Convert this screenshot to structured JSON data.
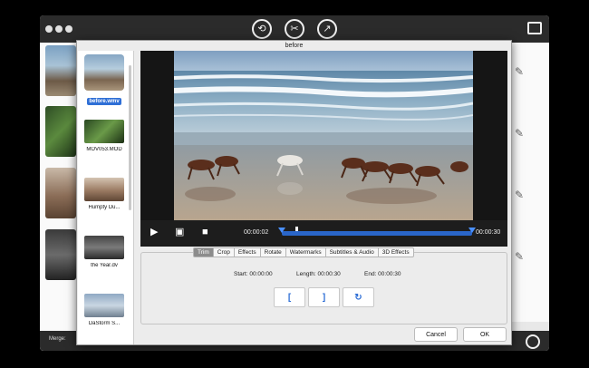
{
  "dialog": {
    "title": "before"
  },
  "files": [
    {
      "label": "before.wmv",
      "selected": true
    },
    {
      "label": "MOV053.MOD",
      "selected": false
    },
    {
      "label": "Humpty Du...",
      "selected": false
    },
    {
      "label": "the Year.dv",
      "selected": false
    },
    {
      "label": "DaStorm S...",
      "selected": false
    }
  ],
  "player": {
    "current_time": "00:00:02",
    "end_time": "00:00:30",
    "progress": 0.07
  },
  "tabs": [
    {
      "label": "Trim",
      "active": true
    },
    {
      "label": "Crop",
      "active": false
    },
    {
      "label": "Effects",
      "active": false
    },
    {
      "label": "Rotate",
      "active": false
    },
    {
      "label": "Watermarks",
      "active": false
    },
    {
      "label": "Subtitles & Audio",
      "active": false
    },
    {
      "label": "3D Effects",
      "active": false
    }
  ],
  "trim": {
    "start": "Start: 00:00:00",
    "length": "Length: 00:00:30",
    "end": "End: 00:00:30",
    "set_start_glyph": "[",
    "set_end_glyph": "]",
    "reset_glyph": "↻"
  },
  "buttons": {
    "cancel": "Cancel",
    "ok": "OK"
  },
  "main_window": {
    "merge_label": "Merge:"
  },
  "colors": {
    "accent": "#2f6fd6",
    "toolbar": "#2b2b2b",
    "selection": "#2f6fd6"
  },
  "icons": {
    "toolbar": [
      "convert-icon",
      "edit-icon",
      "export-icon"
    ],
    "right": "settings-icon",
    "player": [
      "play-icon",
      "frame-icon",
      "stop-icon"
    ],
    "edit": "pencil-icon"
  }
}
